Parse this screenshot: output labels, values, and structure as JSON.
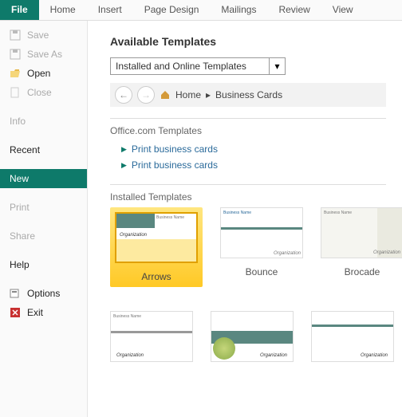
{
  "ribbon": {
    "file": "File",
    "home": "Home",
    "insert": "Insert",
    "page_design": "Page Design",
    "mailings": "Mailings",
    "review": "Review",
    "view": "View"
  },
  "sidebar": {
    "save": "Save",
    "save_as": "Save As",
    "open": "Open",
    "close": "Close",
    "info": "Info",
    "recent": "Recent",
    "new": "New",
    "print": "Print",
    "share": "Share",
    "help": "Help",
    "options": "Options",
    "exit": "Exit"
  },
  "content": {
    "title": "Available Templates",
    "dropdown": "Installed and Online Templates",
    "breadcrumb_home": "Home",
    "breadcrumb_sep": "▸",
    "breadcrumb_cat": "Business Cards",
    "office_section": "Office.com Templates",
    "links": [
      "Print business cards",
      "Print business cards"
    ],
    "installed_section": "Installed Templates",
    "templates": [
      "Arrows",
      "Bounce",
      "Brocade"
    ],
    "org": "Organization"
  }
}
